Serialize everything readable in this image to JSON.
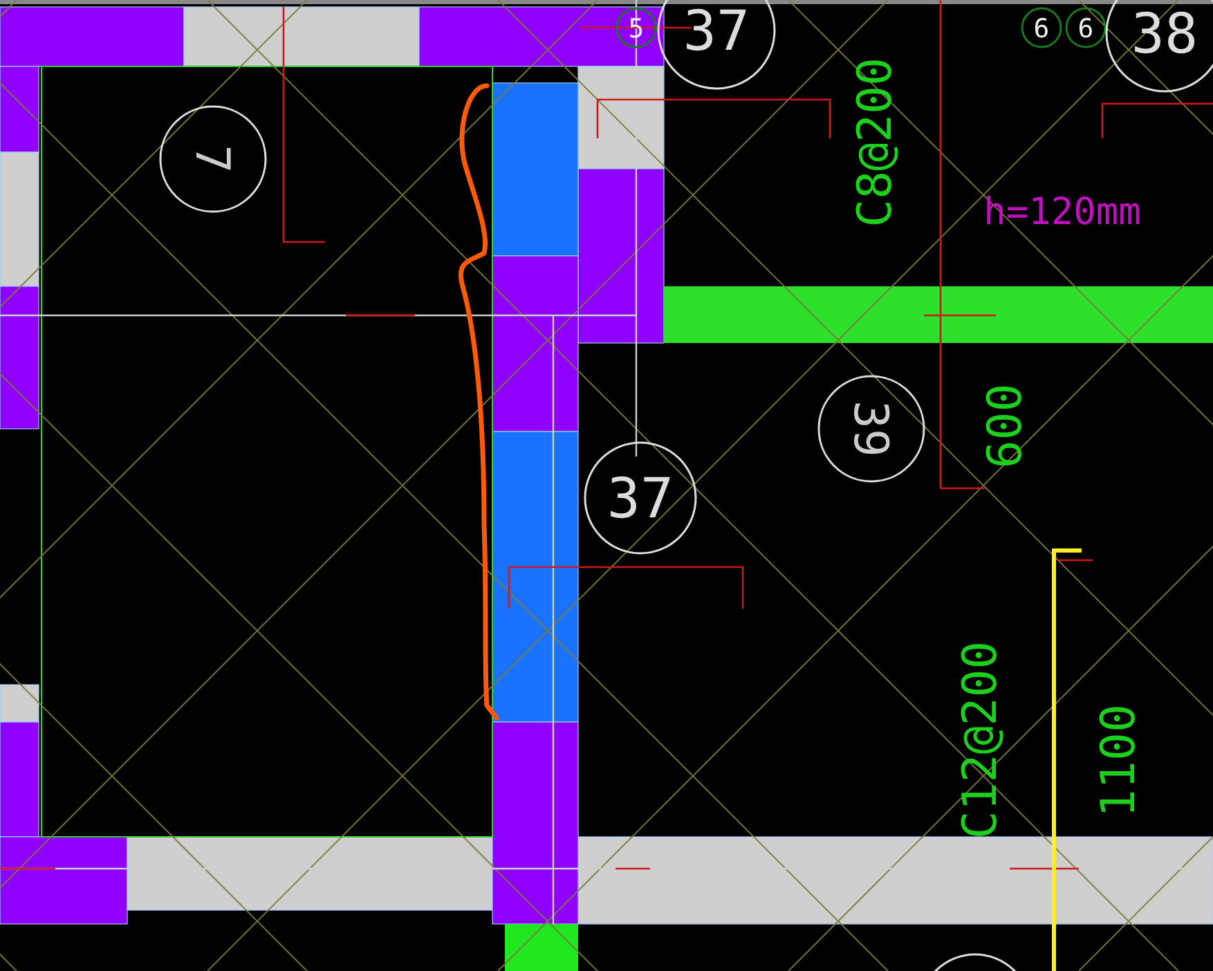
{
  "labels": [
    {
      "text": "5",
      "kind": "small-bubble"
    },
    {
      "text": "37",
      "kind": "bubble"
    },
    {
      "text": "6",
      "kind": "small-bubble"
    },
    {
      "text": "6",
      "kind": "small-bubble"
    },
    {
      "text": "38",
      "kind": "bubble"
    },
    {
      "text": "7",
      "kind": "bubble-rotated"
    },
    {
      "text": "C8@200",
      "kind": "rebar"
    },
    {
      "text": "h=120mm",
      "kind": "thickness"
    },
    {
      "text": "39",
      "kind": "bubble-rotated"
    },
    {
      "text": "600",
      "kind": "rebar"
    },
    {
      "text": "37",
      "kind": "bubble"
    },
    {
      "text": "C12@200",
      "kind": "rebar"
    },
    {
      "text": "1100",
      "kind": "rebar"
    }
  ]
}
